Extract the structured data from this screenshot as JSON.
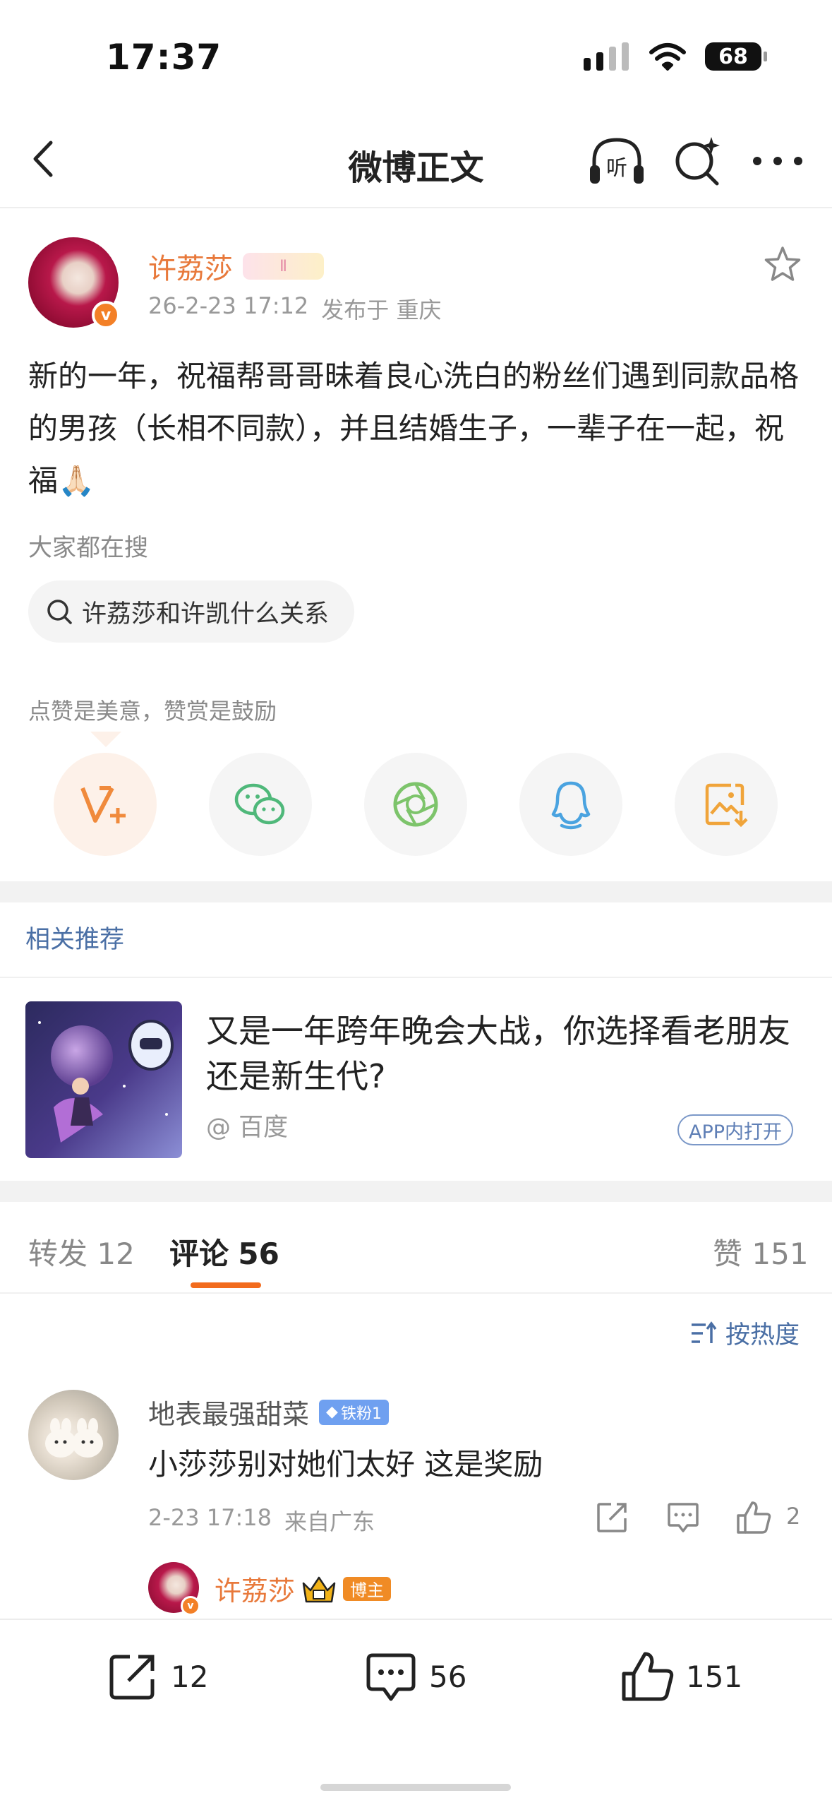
{
  "status_bar": {
    "time": "17:37",
    "battery": "68"
  },
  "nav": {
    "title": "微博正文",
    "listen_label": "听"
  },
  "post": {
    "author": "许荔莎",
    "author_badge": "Ⅱ",
    "date": "26-2-23 17:12",
    "location": "发布于 重庆",
    "text": "新的一年，祝福帮哥哥昧着良心洗白的粉丝们遇到同款品格的男孩（长相不同款），并且结婚生子，一辈子在一起，祝福🙏🏻",
    "search_label": "大家都在搜",
    "search_query": "许荔莎和许凯什么关系",
    "reward_text": "点赞是美意，赞赏是鼓励",
    "share_buttons": [
      "vplus-icon",
      "wechat-icon",
      "moments-icon",
      "qq-icon",
      "save-image-icon"
    ]
  },
  "related": {
    "title": "相关推荐",
    "headline": "又是一年跨年晚会大战，你选择看老朋友还是新生代?",
    "source": "@ 百度",
    "open_label": "APP内打开"
  },
  "tabs": {
    "repost_label": "转发",
    "repost_count": "12",
    "comment_label": "评论",
    "comment_count": "56",
    "like_label": "赞",
    "like_count": "151"
  },
  "sort": {
    "label": "按热度"
  },
  "comment": {
    "user": "地表最强甜菜",
    "fan_badge": "铁粉1",
    "text": "小莎莎别对她们太好   这是奖励",
    "date": "2-23 17:18",
    "location": "来自广东",
    "like_count": "2"
  },
  "reply": {
    "user": "许荔莎",
    "badge": "博主"
  },
  "bottom_bar": {
    "repost_count": "12",
    "comment_count": "56",
    "like_count": "151"
  },
  "colors": {
    "accent": "#f26b1d",
    "username": "#e8793b",
    "link": "#4a6fa5"
  }
}
